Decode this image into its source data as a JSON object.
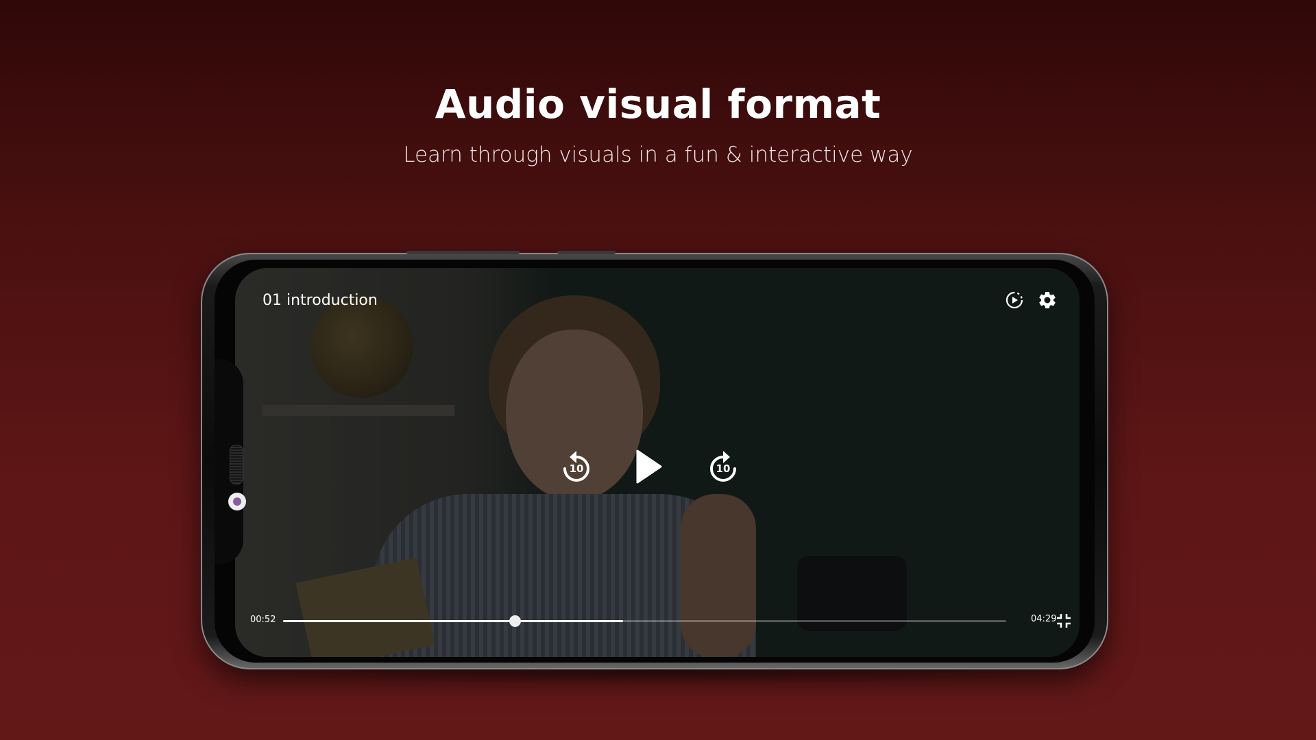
{
  "hero": {
    "title": "Audio visual format",
    "subtitle": "Learn through visuals in a fun & interactive way"
  },
  "colors": {
    "background_top": "#300808",
    "background_bottom": "#631818",
    "text": "#ffffff",
    "camera_lens": "#8a5aa6"
  },
  "player": {
    "video_title": "01 introduction",
    "icons": {
      "autoplay": "autoplay-icon",
      "settings": "gear-icon",
      "rewind": "replay-10-icon",
      "play": "play-icon",
      "forward": "forward-10-icon",
      "exit_fullscreen": "exit-fullscreen-icon"
    },
    "skip_back_seconds": "10",
    "skip_forward_seconds": "10",
    "time_current": "00:52",
    "time_total": "04:29",
    "progress_fraction": 0.32,
    "buffered_fraction": 0.47
  }
}
